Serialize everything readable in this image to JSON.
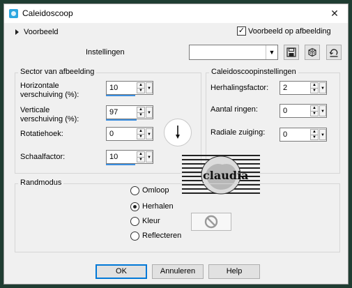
{
  "window": {
    "title": "Caleidoscoop"
  },
  "preview": {
    "label": "Voorbeeld",
    "on_image_label": "Voorbeeld op afbeelding",
    "on_image_checked": true
  },
  "presets": {
    "label": "Instellingen",
    "value": ""
  },
  "sector": {
    "title": "Sector van afbeelding",
    "h_offset": {
      "label_1": "Horizontale",
      "label_2": "verschuiving (%):",
      "value": "10"
    },
    "v_offset": {
      "label_1": "Verticale",
      "label_2": "verschuiving (%):",
      "value": "97"
    },
    "rotation": {
      "label": "Rotatiehoek:",
      "value": "0"
    },
    "scale": {
      "label": "Schaalfactor:",
      "value": "10"
    }
  },
  "kaleido": {
    "title": "Caleidoscoopinstellingen",
    "repeat": {
      "label": "Herhalingsfactor:",
      "value": "2"
    },
    "rings": {
      "label": "Aantal ringen:",
      "value": "0"
    },
    "radial": {
      "label": "Radiale zuiging:",
      "value": "0"
    }
  },
  "edge": {
    "title": "Randmodus",
    "options": [
      "Omloop",
      "Herhalen",
      "Kleur",
      "Reflecteren"
    ],
    "selected": "Herhalen"
  },
  "watermark": {
    "text": "claudia"
  },
  "buttons": {
    "ok": "OK",
    "cancel": "Annuleren",
    "help": "Help"
  }
}
